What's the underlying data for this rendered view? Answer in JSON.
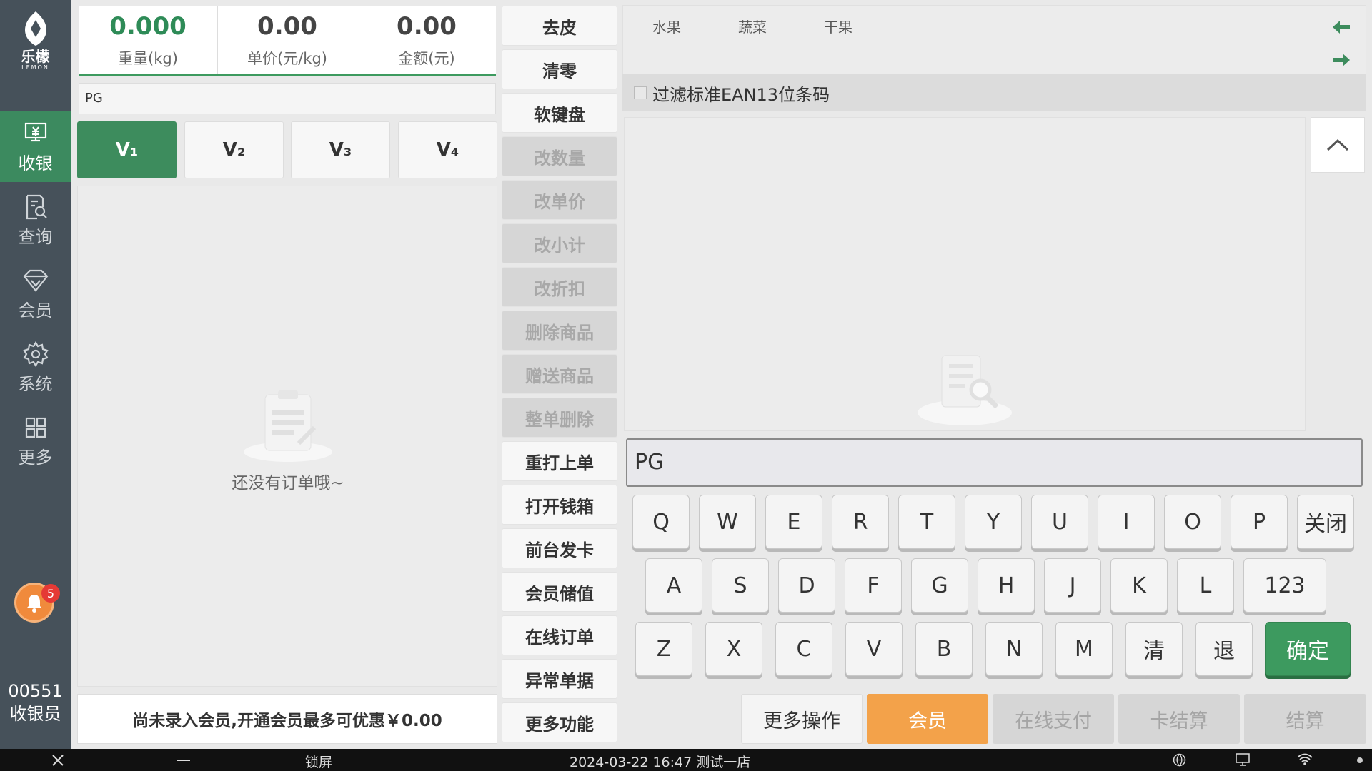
{
  "app": {
    "logo_text": "乐檬",
    "logo_subtext": "LEMON"
  },
  "sidebar": {
    "items": [
      {
        "label": "收银",
        "icon": "cashier-icon",
        "active": true
      },
      {
        "label": "查询",
        "icon": "search-document-icon",
        "active": false
      },
      {
        "label": "会员",
        "icon": "diamond-icon",
        "active": false
      },
      {
        "label": "系统",
        "icon": "gear-icon",
        "active": false
      },
      {
        "label": "更多",
        "icon": "grid-icon",
        "active": false
      }
    ],
    "notification_count": "5",
    "cashier_number": "00551",
    "cashier_role": "收银员"
  },
  "scale": {
    "weight_value": "0.000",
    "weight_label": "重量(kg)",
    "unit_price_value": "0.00",
    "unit_price_label": "单价(元/kg)",
    "amount_value": "0.00",
    "amount_label": "金额(元)"
  },
  "search": {
    "value": "PG"
  },
  "price_levels": [
    "V₁",
    "V₂",
    "V₃",
    "V₄"
  ],
  "order": {
    "empty_text": "还没有订单哦~",
    "member_hint": "尚未录入会员,开通会员最多可优惠￥0.00"
  },
  "functions": [
    {
      "label": "去皮",
      "enabled": true
    },
    {
      "label": "清零",
      "enabled": true
    },
    {
      "label": "软键盘",
      "enabled": true
    },
    {
      "label": "改数量",
      "enabled": false
    },
    {
      "label": "改单价",
      "enabled": false
    },
    {
      "label": "改小计",
      "enabled": false
    },
    {
      "label": "改折扣",
      "enabled": false
    },
    {
      "label": "删除商品",
      "enabled": false
    },
    {
      "label": "赠送商品",
      "enabled": false
    },
    {
      "label": "整单删除",
      "enabled": false
    },
    {
      "label": "重打上单",
      "enabled": true
    },
    {
      "label": "打开钱箱",
      "enabled": true
    },
    {
      "label": "前台发卡",
      "enabled": true
    },
    {
      "label": "会员储值",
      "enabled": true
    },
    {
      "label": "在线订单",
      "enabled": true
    },
    {
      "label": "异常单据",
      "enabled": true
    },
    {
      "label": "更多功能",
      "enabled": true
    }
  ],
  "categories": [
    "水果",
    "蔬菜",
    "干果"
  ],
  "filter": {
    "label": "过滤标准EAN13位条码",
    "checked": false
  },
  "keyboard": {
    "input_value": "PG",
    "row1": [
      "Q",
      "W",
      "E",
      "R",
      "T",
      "Y",
      "U",
      "I",
      "O",
      "P",
      "关闭"
    ],
    "row2": [
      "A",
      "S",
      "D",
      "F",
      "G",
      "H",
      "J",
      "K",
      "L",
      "123"
    ],
    "row3": [
      "Z",
      "X",
      "C",
      "V",
      "B",
      "N",
      "M",
      "清",
      "退"
    ],
    "confirm": "确定"
  },
  "bottom_actions": {
    "more_ops": "更多操作",
    "member": "会员",
    "online_pay": "在线支付",
    "card_settle": "卡结算",
    "settle": "结算"
  },
  "statusbar": {
    "lock": "锁屏",
    "datetime_store": "2024-03-22 16:47 测试一店"
  },
  "colors": {
    "accent_green": "#3d8c5d",
    "member_orange": "#f3a24a",
    "sidebar": "#46515a"
  }
}
